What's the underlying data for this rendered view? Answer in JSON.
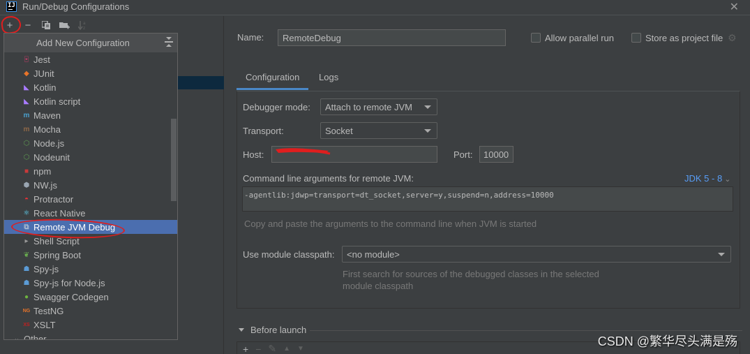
{
  "window": {
    "title": "Run/Debug Configurations",
    "close_icon": "close-icon"
  },
  "toolbar": {
    "buttons": [
      {
        "name": "add",
        "icon": "plus-icon",
        "glyph": "+"
      },
      {
        "name": "remove",
        "icon": "minus-icon",
        "glyph": "−"
      },
      {
        "name": "copy",
        "icon": "copy-icon",
        "glyph": "❐"
      },
      {
        "name": "new-folder",
        "icon": "folder-add-icon",
        "glyph": "▰"
      },
      {
        "name": "sort",
        "icon": "sort-az-icon",
        "glyph": "⇣"
      }
    ]
  },
  "popup": {
    "title": "Add New Configuration",
    "items": [
      {
        "label": "Jest",
        "icon": "jest-icon",
        "glyph": "🃏",
        "color": "#c63d6b"
      },
      {
        "label": "JUnit",
        "icon": "junit-icon",
        "glyph": "◆",
        "color": "#e8742a"
      },
      {
        "label": "Kotlin",
        "icon": "kotlin-icon",
        "glyph": "◣",
        "color": "#a97bff"
      },
      {
        "label": "Kotlin script",
        "icon": "kotlin-script-icon",
        "glyph": "◣",
        "color": "#a97bff"
      },
      {
        "label": "Maven",
        "icon": "maven-icon",
        "glyph": "m",
        "color": "#4a9fcb"
      },
      {
        "label": "Mocha",
        "icon": "mocha-icon",
        "glyph": "m",
        "color": "#8d6748"
      },
      {
        "label": "Node.js",
        "icon": "nodejs-icon",
        "glyph": "⬡",
        "color": "#5f9b52"
      },
      {
        "label": "Nodeunit",
        "icon": "nodeunit-icon",
        "glyph": "⬡",
        "color": "#5f9b52"
      },
      {
        "label": "npm",
        "icon": "npm-icon",
        "glyph": "■",
        "color": "#c93a3a"
      },
      {
        "label": "NW.js",
        "icon": "nwjs-icon",
        "glyph": "⬢",
        "color": "#9aa6b2"
      },
      {
        "label": "Protractor",
        "icon": "protractor-icon",
        "glyph": "◓",
        "color": "#e23237"
      },
      {
        "label": "React Native",
        "icon": "react-icon",
        "glyph": "⚛",
        "color": "#61dafb"
      },
      {
        "label": "Remote JVM Debug",
        "icon": "remote-debug-icon",
        "glyph": "⧉",
        "color": "#a8b8cf",
        "selected": true
      },
      {
        "label": "Shell Script",
        "icon": "shell-icon",
        "glyph": "▸",
        "color": "#9a9a9a"
      },
      {
        "label": "Spring Boot",
        "icon": "spring-boot-icon",
        "glyph": "❦",
        "color": "#6aaf50"
      },
      {
        "label": "Spy-js",
        "icon": "spyjs-icon",
        "glyph": "☗",
        "color": "#5b9bd5"
      },
      {
        "label": "Spy-js for Node.js",
        "icon": "spyjs-node-icon",
        "glyph": "☗",
        "color": "#5b9bd5"
      },
      {
        "label": "Swagger Codegen",
        "icon": "swagger-icon",
        "glyph": "●",
        "color": "#6db33f"
      },
      {
        "label": "TestNG",
        "icon": "testng-icon",
        "glyph": "NG",
        "color": "#e8742a"
      },
      {
        "label": "XSLT",
        "icon": "xslt-icon",
        "glyph": "XS",
        "color": "#c52020"
      },
      {
        "label": "Other",
        "icon": "chevron-down-icon",
        "glyph": "⌄",
        "color": "#bbbbbb"
      }
    ]
  },
  "form": {
    "name_label": "Name:",
    "name_value": "RemoteDebug",
    "allow_parallel_label": "Allow parallel run",
    "allow_parallel_checked": false,
    "store_project_label": "Store as project file",
    "store_project_checked": false,
    "tabs": [
      {
        "label": "Configuration",
        "active": true
      },
      {
        "label": "Logs",
        "active": false
      }
    ],
    "debugger_mode_label": "Debugger mode:",
    "debugger_mode_value": "Attach to remote JVM",
    "transport_label": "Transport:",
    "transport_value": "Socket",
    "host_label": "Host:",
    "host_value": "",
    "port_label": "Port:",
    "port_value": "10000",
    "cmd_label": "Command line arguments for remote JVM:",
    "jdk_link": "JDK 5 - 8",
    "cmd_value": "-agentlib:jdwp=transport=dt_socket,server=y,suspend=n,address=10000",
    "cmd_hint": "Copy and paste the arguments to the command line when JVM is started",
    "module_label": "Use module classpath:",
    "module_value": "<no module>",
    "module_hint_1": "First search for sources of the debugged classes in the selected",
    "module_hint_2": "module classpath",
    "before_launch_label": "Before launch"
  },
  "watermark": "CSDN @繁华尽头满是殇",
  "colors": {
    "background": "#3c3f41",
    "selection": "#4b6eaf",
    "accent_tab": "#4a88c7",
    "link": "#589df6",
    "annotation_red": "#e01e1e"
  }
}
